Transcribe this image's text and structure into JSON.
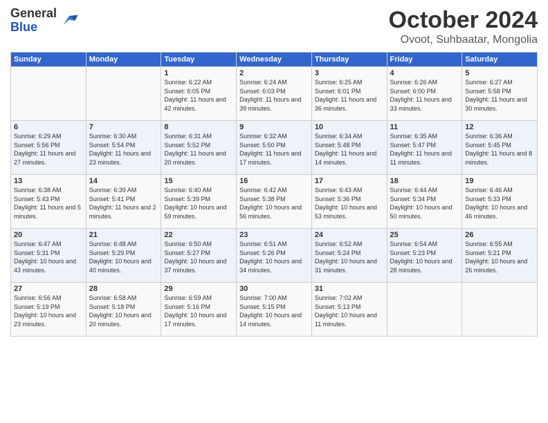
{
  "header": {
    "logo_general": "General",
    "logo_blue": "Blue",
    "title": "October 2024",
    "subtitle": "Ovoot, Suhbaatar, Mongolia"
  },
  "days_of_week": [
    "Sunday",
    "Monday",
    "Tuesday",
    "Wednesday",
    "Thursday",
    "Friday",
    "Saturday"
  ],
  "weeks": [
    [
      {
        "day": "",
        "info": ""
      },
      {
        "day": "",
        "info": ""
      },
      {
        "day": "1",
        "info": "Sunrise: 6:22 AM\nSunset: 6:05 PM\nDaylight: 11 hours and 42 minutes."
      },
      {
        "day": "2",
        "info": "Sunrise: 6:24 AM\nSunset: 6:03 PM\nDaylight: 11 hours and 39 minutes."
      },
      {
        "day": "3",
        "info": "Sunrise: 6:25 AM\nSunset: 6:01 PM\nDaylight: 11 hours and 36 minutes."
      },
      {
        "day": "4",
        "info": "Sunrise: 6:26 AM\nSunset: 6:00 PM\nDaylight: 11 hours and 33 minutes."
      },
      {
        "day": "5",
        "info": "Sunrise: 6:27 AM\nSunset: 5:58 PM\nDaylight: 11 hours and 30 minutes."
      }
    ],
    [
      {
        "day": "6",
        "info": "Sunrise: 6:29 AM\nSunset: 5:56 PM\nDaylight: 11 hours and 27 minutes."
      },
      {
        "day": "7",
        "info": "Sunrise: 6:30 AM\nSunset: 5:54 PM\nDaylight: 11 hours and 23 minutes."
      },
      {
        "day": "8",
        "info": "Sunrise: 6:31 AM\nSunset: 5:52 PM\nDaylight: 11 hours and 20 minutes."
      },
      {
        "day": "9",
        "info": "Sunrise: 6:32 AM\nSunset: 5:50 PM\nDaylight: 11 hours and 17 minutes."
      },
      {
        "day": "10",
        "info": "Sunrise: 6:34 AM\nSunset: 5:48 PM\nDaylight: 11 hours and 14 minutes."
      },
      {
        "day": "11",
        "info": "Sunrise: 6:35 AM\nSunset: 5:47 PM\nDaylight: 11 hours and 11 minutes."
      },
      {
        "day": "12",
        "info": "Sunrise: 6:36 AM\nSunset: 5:45 PM\nDaylight: 11 hours and 8 minutes."
      }
    ],
    [
      {
        "day": "13",
        "info": "Sunrise: 6:38 AM\nSunset: 5:43 PM\nDaylight: 11 hours and 5 minutes."
      },
      {
        "day": "14",
        "info": "Sunrise: 6:39 AM\nSunset: 5:41 PM\nDaylight: 11 hours and 2 minutes."
      },
      {
        "day": "15",
        "info": "Sunrise: 6:40 AM\nSunset: 5:39 PM\nDaylight: 10 hours and 59 minutes."
      },
      {
        "day": "16",
        "info": "Sunrise: 6:42 AM\nSunset: 5:38 PM\nDaylight: 10 hours and 56 minutes."
      },
      {
        "day": "17",
        "info": "Sunrise: 6:43 AM\nSunset: 5:36 PM\nDaylight: 10 hours and 53 minutes."
      },
      {
        "day": "18",
        "info": "Sunrise: 6:44 AM\nSunset: 5:34 PM\nDaylight: 10 hours and 50 minutes."
      },
      {
        "day": "19",
        "info": "Sunrise: 6:46 AM\nSunset: 5:33 PM\nDaylight: 10 hours and 46 minutes."
      }
    ],
    [
      {
        "day": "20",
        "info": "Sunrise: 6:47 AM\nSunset: 5:31 PM\nDaylight: 10 hours and 43 minutes."
      },
      {
        "day": "21",
        "info": "Sunrise: 6:48 AM\nSunset: 5:29 PM\nDaylight: 10 hours and 40 minutes."
      },
      {
        "day": "22",
        "info": "Sunrise: 6:50 AM\nSunset: 5:27 PM\nDaylight: 10 hours and 37 minutes."
      },
      {
        "day": "23",
        "info": "Sunrise: 6:51 AM\nSunset: 5:26 PM\nDaylight: 10 hours and 34 minutes."
      },
      {
        "day": "24",
        "info": "Sunrise: 6:52 AM\nSunset: 5:24 PM\nDaylight: 10 hours and 31 minutes."
      },
      {
        "day": "25",
        "info": "Sunrise: 6:54 AM\nSunset: 5:23 PM\nDaylight: 10 hours and 28 minutes."
      },
      {
        "day": "26",
        "info": "Sunrise: 6:55 AM\nSunset: 5:21 PM\nDaylight: 10 hours and 26 minutes."
      }
    ],
    [
      {
        "day": "27",
        "info": "Sunrise: 6:56 AM\nSunset: 5:19 PM\nDaylight: 10 hours and 23 minutes."
      },
      {
        "day": "28",
        "info": "Sunrise: 6:58 AM\nSunset: 5:18 PM\nDaylight: 10 hours and 20 minutes."
      },
      {
        "day": "29",
        "info": "Sunrise: 6:59 AM\nSunset: 5:16 PM\nDaylight: 10 hours and 17 minutes."
      },
      {
        "day": "30",
        "info": "Sunrise: 7:00 AM\nSunset: 5:15 PM\nDaylight: 10 hours and 14 minutes."
      },
      {
        "day": "31",
        "info": "Sunrise: 7:02 AM\nSunset: 5:13 PM\nDaylight: 10 hours and 11 minutes."
      },
      {
        "day": "",
        "info": ""
      },
      {
        "day": "",
        "info": ""
      }
    ]
  ]
}
